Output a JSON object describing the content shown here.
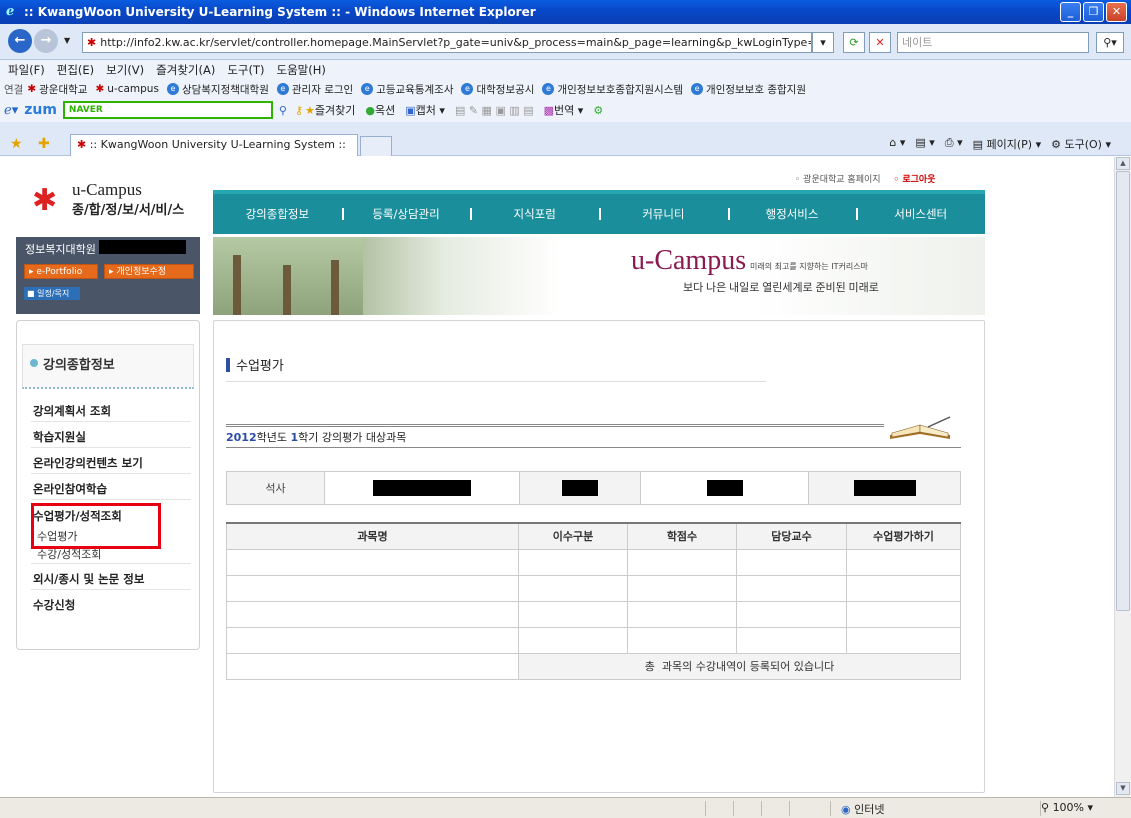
{
  "window": {
    "title": ":: KwangWoon University U-Learning System :: - Windows Internet Explorer"
  },
  "address": {
    "url": "http://info2.kw.ac.kr/servlet/controller.homepage.MainServlet?p_gate=univ&p_process=main&p_page=learning&p_kwLoginType=",
    "search_placeholder": "네이트"
  },
  "menubar": [
    "파일(F)",
    "편집(E)",
    "보기(V)",
    "즐겨찾기(A)",
    "도구(T)",
    "도움말(H)"
  ],
  "links": {
    "label": "연결",
    "items": [
      "광운대학교",
      "u-campus",
      "상담복지정책대학원",
      "관리자 로그인",
      "고등교육통계조사",
      "대학정보공시",
      "개인정보보호종합지원시스템",
      "개인정보보호 종합지원"
    ]
  },
  "toolbar": {
    "zum": "zum",
    "naver": "NAVER",
    "items": [
      "즐겨찾기",
      "옥션",
      "캡처",
      "번역"
    ]
  },
  "tab": {
    "title": ":: KwangWoon University U-Learning System ::",
    "tools": [
      "페이지(P)",
      "도구(O)"
    ]
  },
  "site": {
    "logo_top": "u-Campus",
    "logo_bottom": "종/합/정/보/서/비/스",
    "toplink_home": "광운대학교 홈페이지",
    "toplink_logout": "로그아웃",
    "nav": [
      "강의종합정보",
      "등록/상담관리",
      "지식포럼",
      "커뮤니티",
      "행정서비스",
      "서비스센터"
    ],
    "user_dept": "정보복지대학원",
    "btn_portfolio": "e-Portfolio",
    "btn_info": "개인정보수정",
    "btn_schedule": "일정/목지",
    "banner_title": "u-Campus",
    "banner_tag": "미래의 최고를 지향하는 IT커리스마",
    "banner_sub": "보다 나은 내일로 열린세계로 준비된 미래로"
  },
  "sidebar": {
    "title": "강의종합정보",
    "items": [
      "강의계획서 조회",
      "학습지원실",
      "온라인강의컨텐츠 보기",
      "온라인참여학습",
      "수업평가/성적조회"
    ],
    "subitems": [
      "수업평가",
      "수강/성적조회"
    ],
    "items2": [
      "외시/종시 및 논문 정보",
      "수강신청"
    ]
  },
  "content": {
    "page_title": "수업평가",
    "year": "2012",
    "year_suffix": "학년도",
    "term": "1",
    "term_suffix": "학기 강의평가 대상과목",
    "degree": "석사",
    "columns": [
      "과목명",
      "이수구분",
      "학점수",
      "담당교수",
      "수업평가하기"
    ],
    "note": "총  과목의 수강내역이 등록되어 있습니다"
  },
  "status": {
    "zone": "인터넷",
    "zoom": "100%"
  }
}
